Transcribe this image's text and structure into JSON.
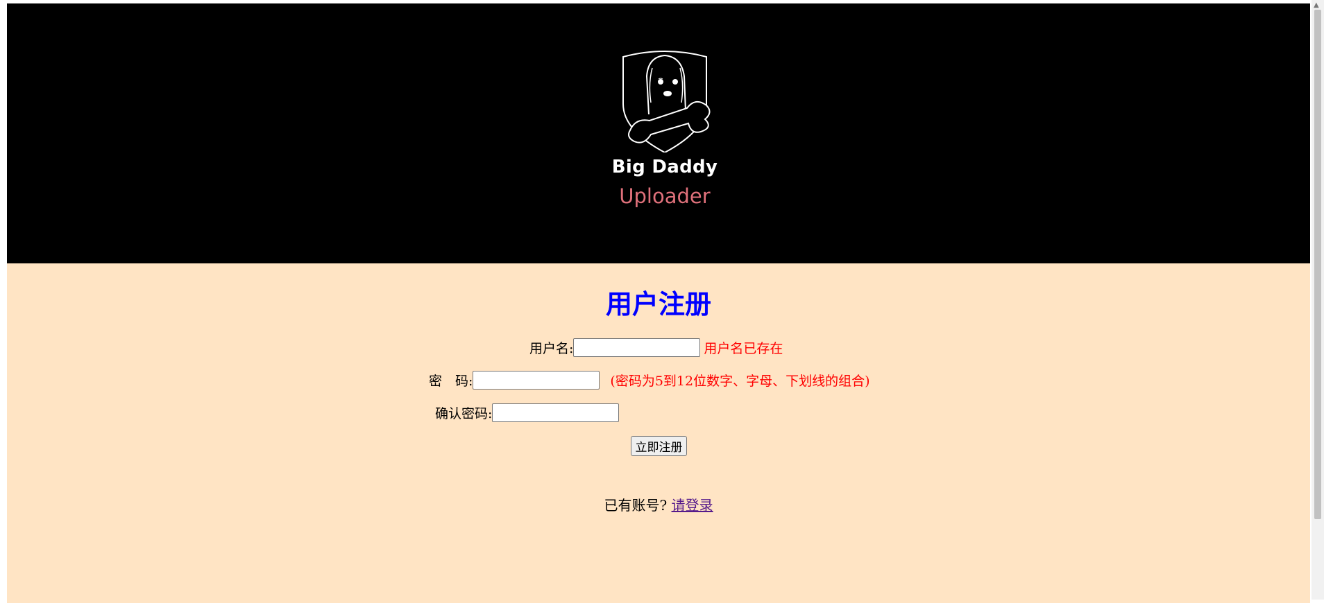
{
  "brand": {
    "name_line1": "Big Daddy",
    "name_line2": "Uploader",
    "colors": {
      "name_line1": "#ffffff",
      "name_line2": "#e0717b",
      "header_bg": "#000000"
    },
    "logo_icon": "dog-with-bone-shield-icon"
  },
  "register_form": {
    "title": "用户注册",
    "username": {
      "label": "用户名:",
      "value": "",
      "error": "用户名已存在"
    },
    "password": {
      "label": "密　码:",
      "value": "",
      "hint": "(密码为5到12位数字、字母、下划线的组合)"
    },
    "confirm_password": {
      "label": "确认密码:",
      "value": ""
    },
    "submit_label": "立即注册",
    "colors": {
      "title": "#0000ff",
      "error": "#ff0000",
      "background": "#ffe4c4"
    }
  },
  "footer": {
    "prompt": "已有账号?",
    "login_link": "请登录"
  }
}
